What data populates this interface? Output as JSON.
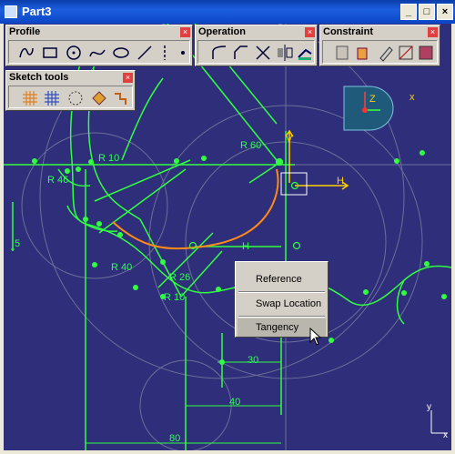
{
  "window": {
    "title": "Part3",
    "buttons": {
      "minimize": "_",
      "maximize": "□",
      "close": "×"
    }
  },
  "toolbars": {
    "profile": {
      "title": "Profile",
      "close": "×"
    },
    "operation": {
      "title": "Operation",
      "close": "×"
    },
    "constraint": {
      "title": "Constraint",
      "close": "×"
    },
    "sketch_tools": {
      "title": "Sketch tools",
      "close": "×"
    }
  },
  "compass": {
    "z_label": "Z",
    "x_label": "x"
  },
  "sketch": {
    "axis_v_label": "V",
    "axis_h_label": "H",
    "dimensions": {
      "r60": "R 60",
      "r10_top": "R 10",
      "r46": "R 46",
      "r40": "R 40",
      "r26": "R 26",
      "r10_bottom": "R 10",
      "d5": "5",
      "d30": "30",
      "d40": "40",
      "d80": "80"
    },
    "h_marker": "H",
    "corner_y": "y",
    "corner_x": "x"
  },
  "context_menu": {
    "items": [
      {
        "label": "Reference"
      },
      {
        "label": "Swap Location"
      },
      {
        "label": "Tangency"
      }
    ],
    "highlighted": "Tangency"
  }
}
